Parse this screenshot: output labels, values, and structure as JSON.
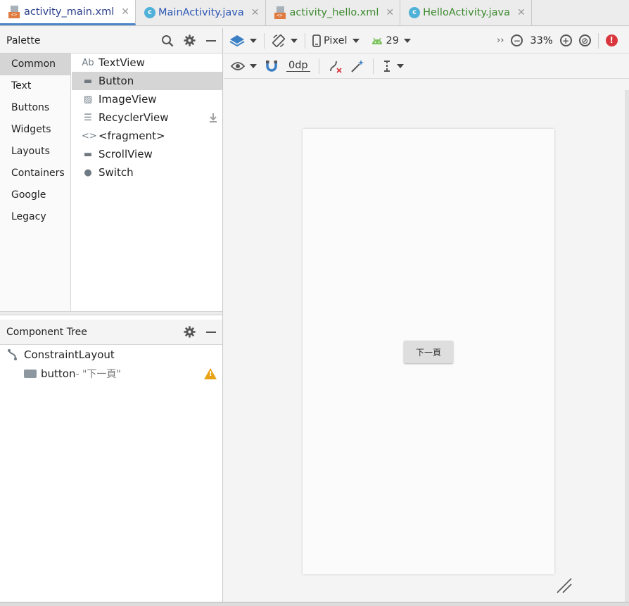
{
  "tabs": [
    {
      "label": "activity_main.xml",
      "icon": "xml-layout-icon",
      "active": true
    },
    {
      "label": "MainActivity.java",
      "icon": "java-class-icon",
      "active": false
    },
    {
      "label": "activity_hello.xml",
      "icon": "xml-layout-icon",
      "active": false
    },
    {
      "label": "HelloActivity.java",
      "icon": "java-class-icon",
      "active": false
    }
  ],
  "tab_close": "✕",
  "class_letter": "c",
  "xml_badge": "<>",
  "palette": {
    "title": "Palette",
    "categories": [
      "Common",
      "Text",
      "Buttons",
      "Widgets",
      "Layouts",
      "Containers",
      "Google",
      "Legacy"
    ],
    "selected_category": "Common",
    "items": [
      {
        "label": "TextView",
        "icon": "Ab"
      },
      {
        "label": "Button",
        "icon": "▬"
      },
      {
        "label": "ImageView",
        "icon": "▨"
      },
      {
        "label": "RecyclerView",
        "icon": "☰"
      },
      {
        "label": "<fragment>",
        "icon": "<>"
      },
      {
        "label": "ScrollView",
        "icon": "▬"
      },
      {
        "label": "Switch",
        "icon": "●"
      }
    ],
    "selected_item": "Button"
  },
  "component_tree": {
    "title": "Component Tree",
    "root": "ConstraintLayout",
    "child_name": "button",
    "child_sub": "- \"下一頁\"",
    "warning_glyph": "!"
  },
  "toolbar": {
    "device": "Pixel",
    "api": "29",
    "overflow": "››",
    "zoom": "33%",
    "margin": "0dp",
    "zoom_out_glyph": "−",
    "zoom_in_glyph": "+",
    "fit_glyph": "⊘",
    "error_glyph": "!"
  },
  "canvas": {
    "button_text": "下一頁"
  },
  "colors": {
    "accent": "#4a86c8",
    "warning": "#e8a317",
    "error": "#d9363e",
    "android_green": "#7cc25c"
  }
}
